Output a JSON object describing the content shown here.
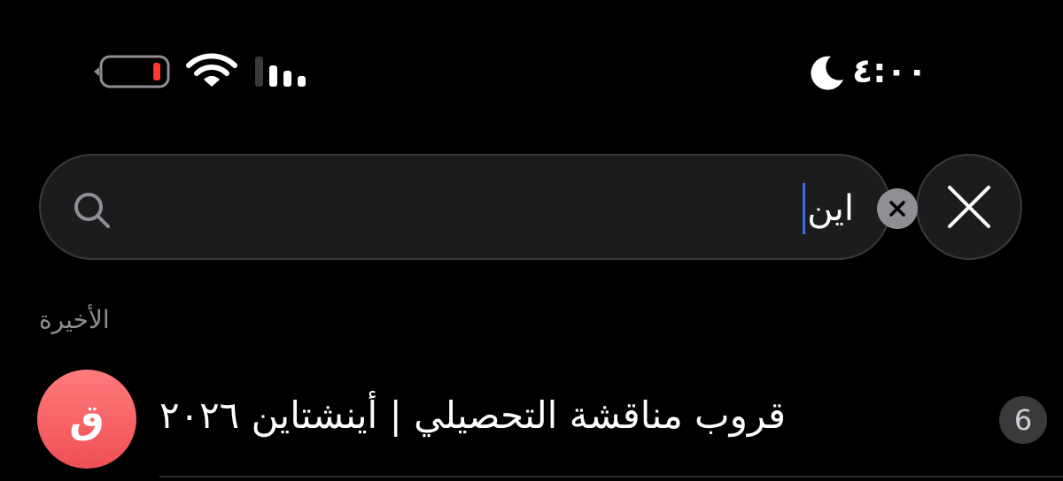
{
  "status_bar": {
    "time": "٤:٠٠",
    "battery_level": 0.1,
    "battery_color": "#ff3b30",
    "signal_bars_active": 3,
    "do_not_disturb": true,
    "icons": [
      "battery-icon",
      "wifi-icon",
      "cellular-signal-icon",
      "moon-icon"
    ]
  },
  "search": {
    "value": "اين",
    "icons": [
      "search-icon",
      "clear-text-icon",
      "close-icon"
    ]
  },
  "recents": {
    "section_title": "الأخيرة",
    "items": [
      {
        "avatar_letter": "ق",
        "avatar_color": "#f5575c",
        "title": "قروب مناقشة التحصيلي | أينشتاين ٢٠٢٦",
        "unread_count": "6"
      }
    ]
  },
  "colors": {
    "background": "#000000",
    "field_background": "#1c1c1e",
    "caret": "#3a6fd8",
    "secondary_text": "#8e8e93"
  }
}
